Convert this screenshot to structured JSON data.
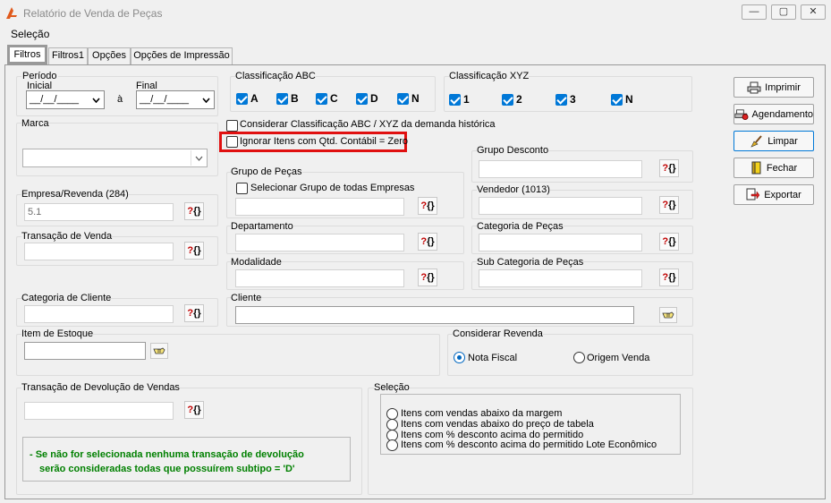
{
  "window": {
    "title": "Relatório de Venda de Peças",
    "minimize": "—",
    "maximize": "▢",
    "close": "✕"
  },
  "menu": {
    "selecao": "Seleção"
  },
  "tabs": [
    {
      "label": "Filtros"
    },
    {
      "label": "Filtros1"
    },
    {
      "label": "Opções"
    },
    {
      "label": "Opções de Impressão"
    }
  ],
  "periodo": {
    "title": "Período",
    "inicial_label": "Inicial",
    "final_label": "Final",
    "separator": "à",
    "inicial_value": "__/__/____",
    "final_value": "__/__/____"
  },
  "marca": {
    "title": "Marca",
    "value": ""
  },
  "empresa": {
    "title": "Empresa/Revenda (284)",
    "value": "5.1"
  },
  "transacao_venda": {
    "title": "Transação de Venda",
    "value": ""
  },
  "categoria_cliente": {
    "title": "Categoria de Cliente",
    "value": ""
  },
  "item_estoque": {
    "title": "Item de Estoque",
    "value": ""
  },
  "transacao_devolucao": {
    "title": "Transação de Devolução de Vendas",
    "value": "",
    "note_line1": "- Se não for selecionada nenhuma transação de devolução",
    "note_line2": "serão consideradas todas que possuírem subtipo = 'D'"
  },
  "classificacao_abc": {
    "title": "Classificação ABC",
    "options": [
      "A",
      "B",
      "C",
      "D",
      "N"
    ]
  },
  "classificacao_xyz": {
    "title": "Classificação XYZ",
    "options": [
      "1",
      "2",
      "3",
      "N"
    ]
  },
  "considerar_classificacao": "Considerar Classificação ABC / XYZ da demanda histórica",
  "ignorar_itens": "Ignorar Itens com Qtd. Contábil = Zero",
  "grupo_pecas": {
    "title": "Grupo de Peças",
    "checkbox": "Selecionar Grupo de todas Empresas"
  },
  "departamento": {
    "title": "Departamento"
  },
  "modalidade": {
    "title": "Modalidade"
  },
  "cliente": {
    "title": "Cliente"
  },
  "grupo_desconto": {
    "title": "Grupo Desconto"
  },
  "vendedor": {
    "title": "Vendedor (1013)"
  },
  "categoria_pecas": {
    "title": "Categoria de Peças"
  },
  "subcategoria_pecas": {
    "title": "Sub Categoria de Peças"
  },
  "considerar_revenda": {
    "title": "Considerar Revenda",
    "opt1": "Nota Fiscal",
    "opt2": "Origem Venda",
    "selected": "Nota Fiscal"
  },
  "selecao": {
    "title": "Seleção",
    "items": [
      "Itens com vendas abaixo da margem",
      "Itens com vendas abaixo do preço de tabela",
      "Itens com % desconto acima do permitido",
      "Itens com % desconto acima do permitido Lote Econômico"
    ]
  },
  "buttons": {
    "imprimir": "Imprimir",
    "agendamento": "Agendamento",
    "limpar": "Limpar",
    "fechar": "Fechar",
    "exportar": "Exportar"
  },
  "lookup": {
    "q": "?",
    "b": "{}"
  },
  "colors": {
    "accent": "#0078d7",
    "highlight": "#e01010",
    "note": "#008000"
  }
}
